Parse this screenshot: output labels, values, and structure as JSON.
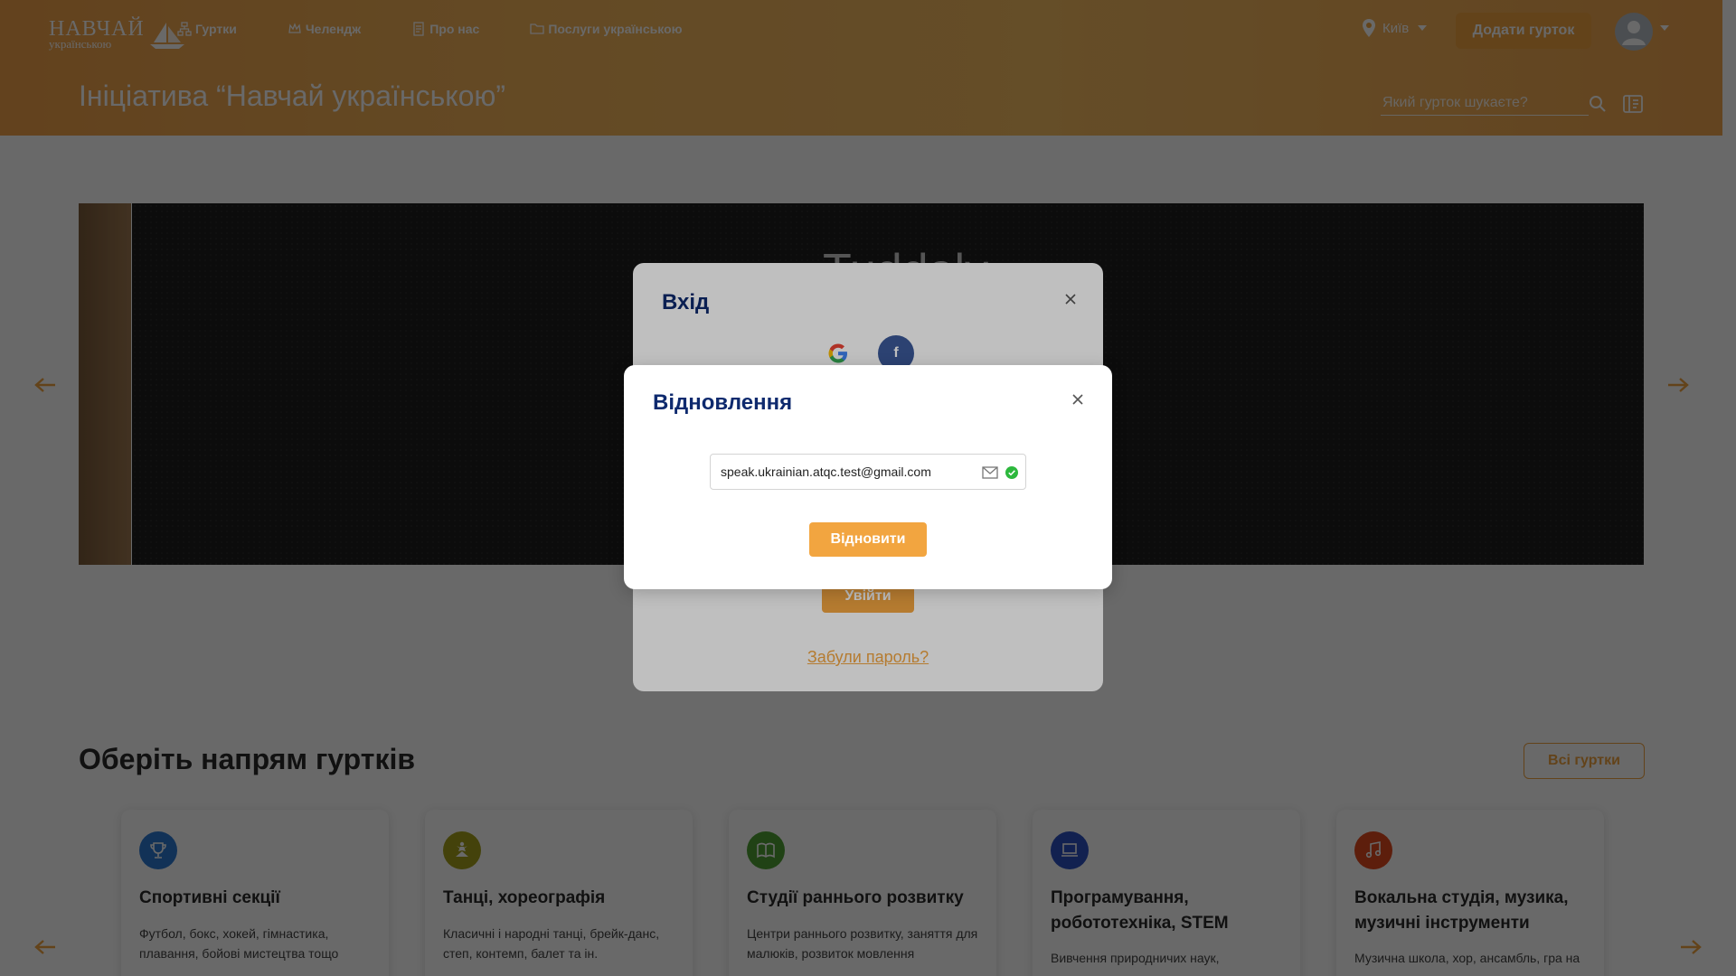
{
  "header": {
    "logo_line1": "НАВЧАЙ",
    "logo_line2": "українською",
    "nav": [
      {
        "label": "Гуртки",
        "icon": "clubs-icon"
      },
      {
        "label": "Челендж",
        "icon": "challenge-icon"
      },
      {
        "label": "Про нас",
        "icon": "document-icon"
      },
      {
        "label": "Послуги українською",
        "icon": "folder-icon"
      }
    ],
    "city": "Київ",
    "add_club": "Додати гурток",
    "title": "Ініціатива “Навчай українською”",
    "search_placeholder": "Який гурток шукаєте?"
  },
  "banner": {
    "title": "Tuddaly"
  },
  "categories": {
    "heading": "Оберіть напрям гуртків",
    "all_button": "Всі гуртки",
    "items": [
      {
        "title": "Спортивні секції",
        "desc": "Футбол, бокс, хокей, гімнастика, плавання, бойові мистецтва тощо",
        "icon": "trophy-icon",
        "color": "#2e7bd6"
      },
      {
        "title": "Танці, хореографія",
        "desc": "Класичні і народні танці, брейк-данс, степ, контемп, балет та ін.",
        "icon": "dance-icon",
        "color": "#a6a21c"
      },
      {
        "title": "Студії раннього розвитку",
        "desc": "Центри раннього розвитку, заняття для малюків, розвиток мовлення",
        "icon": "book-icon",
        "color": "#4fa336"
      },
      {
        "title": "Програмування, робототехніка, STEM",
        "desc": "Вивчення природничих наук,",
        "icon": "laptop-icon",
        "color": "#2f52c4"
      },
      {
        "title": "Вокальна студія, музика, музичні інструменти",
        "desc": "Музична школа, хор, ансамбль, гра на",
        "icon": "music-icon",
        "color": "#e24a1f"
      }
    ]
  },
  "login_modal": {
    "title": "Вхід",
    "login_button": "Увійти",
    "forgot_link": "Забули пароль?"
  },
  "restore_modal": {
    "title": "Відновлення",
    "email_value": "speak.ukrainian.atqc.test@gmail.com",
    "submit": "Відновити"
  },
  "colors": {
    "accent": "#f2a540",
    "modal_title": "#0e2a6e",
    "valid_check": "#2db83d"
  }
}
